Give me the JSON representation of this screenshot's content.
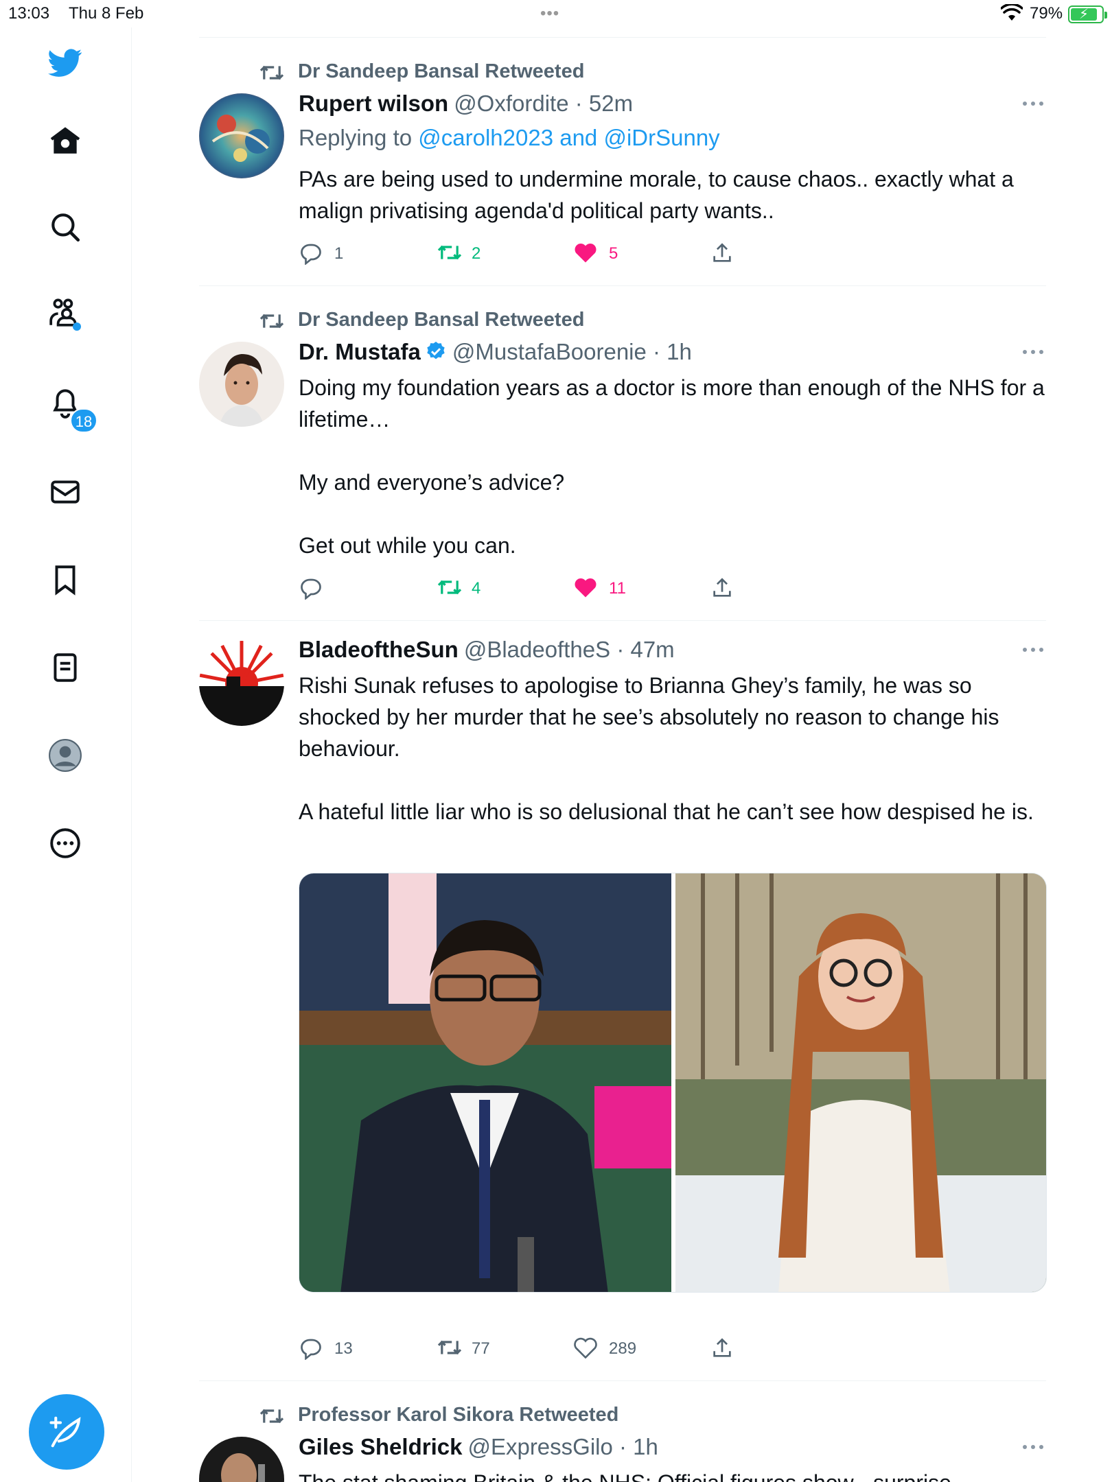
{
  "status_bar": {
    "time": "13:03",
    "date": "Thu 8 Feb",
    "battery": "79%"
  },
  "sidebar": {
    "notifications_badge": "18",
    "items": [
      {
        "icon": "twitter-bird-icon"
      },
      {
        "icon": "home-icon"
      },
      {
        "icon": "search-icon"
      },
      {
        "icon": "communities-icon"
      },
      {
        "icon": "notifications-bell-icon"
      },
      {
        "icon": "messages-icon"
      },
      {
        "icon": "bookmarks-icon"
      },
      {
        "icon": "lists-icon"
      },
      {
        "icon": "profile-icon"
      },
      {
        "icon": "more-circle-icon"
      }
    ],
    "compose_icon": "compose-feather-icon"
  },
  "colors": {
    "accent": "#1d9bf0",
    "retweet_green": "#00ba7c",
    "like_pink": "#f91880",
    "secondary_text": "#536471"
  },
  "tweets": [
    {
      "retweeted_by": "Dr Sandeep Bansal Retweeted",
      "name": "Rupert wilson",
      "handle": "@Oxfordite · 52m",
      "replying_prefix": "Replying to ",
      "replying_to": "@carolh2023 and @iDrSunny",
      "text": "PAs are being used to undermine morale, to cause chaos.. exactly what a malign privatising agenda'd political party wants..",
      "replies": "1",
      "retweets": "2",
      "likes": "5"
    },
    {
      "retweeted_by": "Dr Sandeep Bansal Retweeted",
      "name": "Dr. Mustafa",
      "handle": "@MustafaBoorenie · 1h",
      "text": "Doing my foundation years as a doctor is more than enough of the NHS for a lifetime…\n\nMy and everyone’s advice?\n\nGet out while you can.",
      "replies": "",
      "retweets": "4",
      "likes": "11"
    },
    {
      "name": "BladeoftheSun",
      "handle": "@BladeoftheS · 47m",
      "text": "Rishi Sunak refuses to apologise to Brianna Ghey’s family, he was so shocked by her murder that he see’s absolutely no reason to change his behaviour.\n\nA hateful little liar who is so delusional that he can’t see how despised he is.",
      "replies": "13",
      "retweets": "77",
      "likes": "289"
    },
    {
      "retweeted_by": "Professor Karol Sikora Retweeted",
      "name": "Giles Sheldrick",
      "handle": "@ExpressGilo · 1h",
      "text": "The stat shaming Britain & the NHS: Official figures show - surprise"
    }
  ]
}
